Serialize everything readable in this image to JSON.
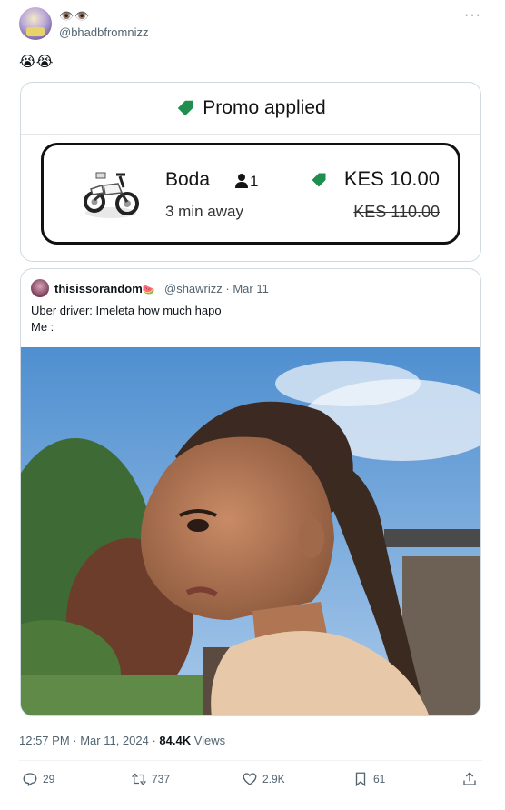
{
  "header": {
    "display_name": "👁️👁️",
    "handle": "@bhadbfromnizz",
    "more_label": "···"
  },
  "tweet": {
    "text": "😭😭"
  },
  "promo_card": {
    "title": "Promo applied",
    "ride": {
      "name": "Boda",
      "passengers": "1",
      "eta": "3 min away",
      "price": "KES 10.00",
      "old_price": "KES 110.00"
    },
    "tag_color": "#1f8f4f"
  },
  "quote": {
    "name": "thisissorandom",
    "emoji": "🍉",
    "meta": "@shawrizz · Mar 11",
    "line1": "Uber driver: Imeleta how much hapo",
    "line2": "Me :"
  },
  "footer": {
    "time": "12:57 PM · Mar 11, 2024 · ",
    "views_count": "84.4K",
    "views_label": " Views"
  },
  "actions": {
    "replies": "29",
    "reposts": "737",
    "likes": "2.9K",
    "bookmarks": "61"
  },
  "icons": [
    "more-icon",
    "tag-icon",
    "motorcycle-icon",
    "person-icon",
    "reply-icon",
    "repost-icon",
    "like-icon",
    "bookmark-icon",
    "share-icon"
  ]
}
